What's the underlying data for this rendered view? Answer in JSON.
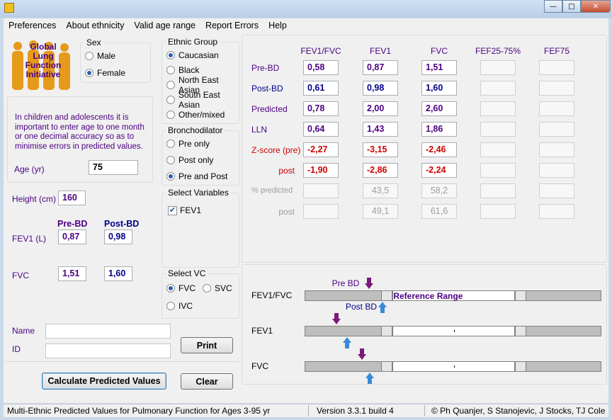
{
  "menu": [
    "Preferences",
    "About ethnicity",
    "Valid age range",
    "Report Errors",
    "Help"
  ],
  "logo": {
    "l1": "Global",
    "l2": "Lung",
    "l3": "Function",
    "l4": "Initiative"
  },
  "sex": {
    "title": "Sex",
    "male": "Male",
    "female": "Female"
  },
  "ethnic": {
    "title": "Ethnic Group",
    "opts": [
      "Caucasian",
      "Black",
      "North East Asian",
      "South East Asian",
      "Other/mixed"
    ]
  },
  "broncho": {
    "title": "Bronchodilator",
    "opts": [
      "Pre only",
      "Post only",
      "Pre and Post"
    ]
  },
  "selvars": {
    "title": "Select Variables",
    "fev1": "FEV1"
  },
  "selvc": {
    "title": "Select VC",
    "fvc": "FVC",
    "svc": "SVC",
    "ivc": "IVC"
  },
  "note": "In children and adolescents it is important to enter age to one month or one decimal accuracy so as to minimise errors in predicted values.",
  "age": {
    "label": "Age (yr)",
    "value": "75"
  },
  "height": {
    "label": "Height (cm)",
    "value": "160"
  },
  "inputs": {
    "pre_hdr": "Pre-BD",
    "post_hdr": "Post-BD",
    "fev1_label": "FEV1 (L)",
    "fev1_pre": "0,87",
    "fev1_post": "0,98",
    "fvc_label": "FVC",
    "fvc_pre": "1,51",
    "fvc_post": "1,60"
  },
  "name_label": "Name",
  "id_label": "ID",
  "buttons": {
    "print": "Print",
    "calc": "Calculate Predicted Values",
    "clear": "Clear"
  },
  "results": {
    "cols": [
      "FEV1/FVC",
      "FEV1",
      "FVC",
      "FEF25-75%",
      "FEF75"
    ],
    "rows": [
      {
        "label": "Pre-BD",
        "vals": [
          "0,58",
          "0,87",
          "1,51",
          "",
          ""
        ]
      },
      {
        "label": "Post-BD",
        "vals": [
          "0,61",
          "0,98",
          "1,60",
          "",
          ""
        ]
      },
      {
        "label": "Predicted",
        "vals": [
          "0,78",
          "2,00",
          "2,60",
          "",
          ""
        ]
      },
      {
        "label": "LLN",
        "vals": [
          "0,64",
          "1,43",
          "1,86",
          "",
          ""
        ]
      },
      {
        "label": "Z-score (pre)",
        "vals": [
          "-2,27",
          "-3,15",
          "-2,46",
          "",
          ""
        ]
      },
      {
        "label": "post",
        "vals": [
          "-1,90",
          "-2,86",
          "-2,24",
          "",
          ""
        ]
      },
      {
        "label": "% predicted",
        "vals": [
          "",
          "43,5",
          "58,2",
          "",
          ""
        ]
      },
      {
        "label": "post",
        "vals": [
          "",
          "49,1",
          "61,6",
          "",
          ""
        ]
      }
    ]
  },
  "graph": {
    "labels": [
      "FEV1/FVC",
      "FEV1",
      "FVC"
    ],
    "pre_label": "Pre BD",
    "post_label": "Post BD",
    "ref_label": "Reference Range",
    "z_pre": [
      -2.27,
      -3.15,
      -2.46
    ],
    "z_post": [
      -1.9,
      -2.86,
      -2.24
    ]
  },
  "status": {
    "s1": "Multi-Ethnic Predicted Values for Pulmonary Function for Ages 3-95 yr",
    "s2": "Version 3.3.1 build 4",
    "s3": "© Ph Quanjer, S Stanojevic, J Stocks, TJ Cole"
  },
  "colors": {
    "blue": "#00008b",
    "red": "#d00000",
    "purple": "#4b0082",
    "pre_arrow": "#7a1a7a",
    "post_arrow": "#3a8ad8"
  }
}
